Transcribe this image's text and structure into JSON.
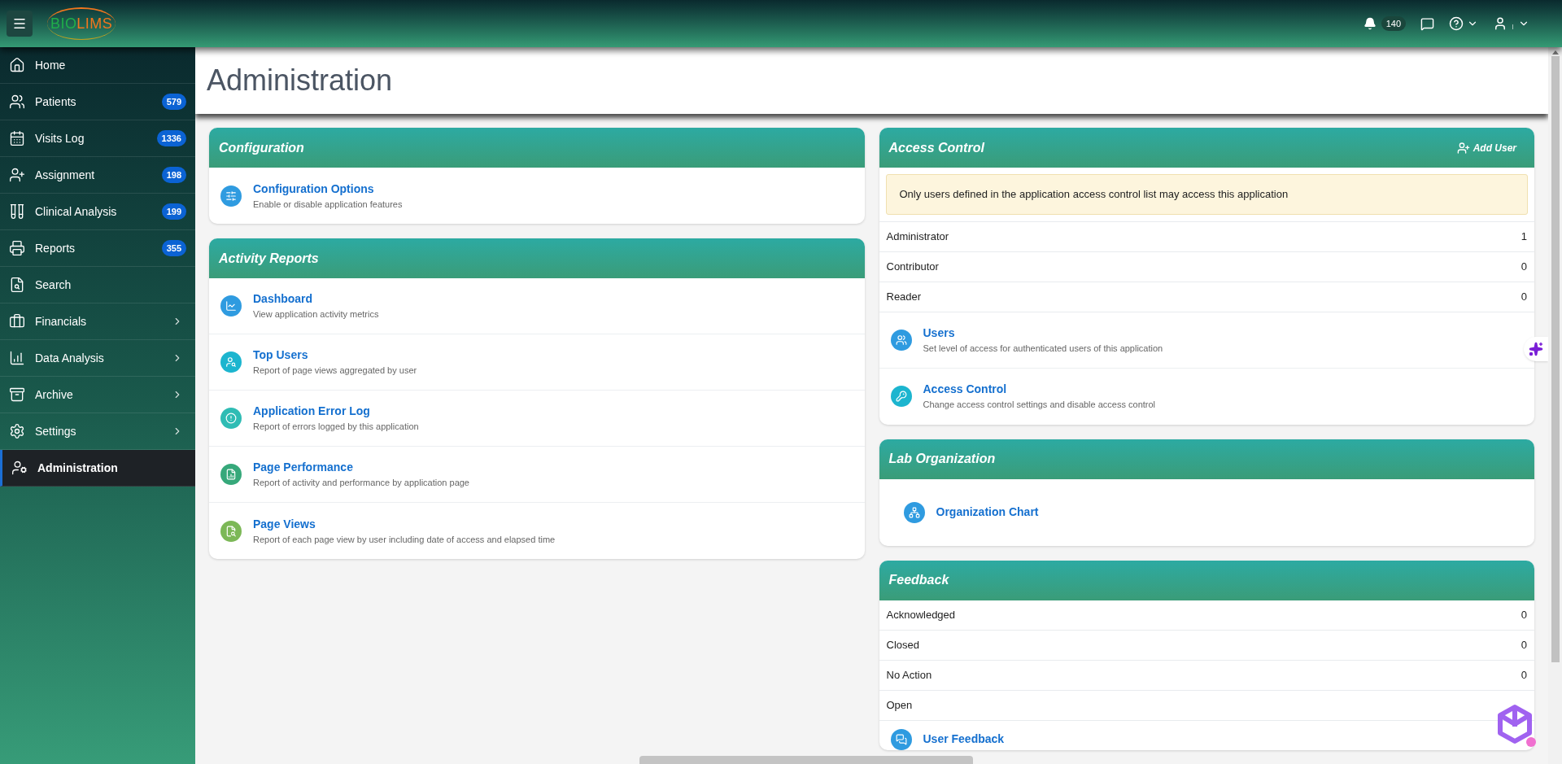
{
  "header": {
    "logo": [
      {
        "text": "BIO",
        "color": "#1fae4a"
      },
      {
        "text": "LIMS",
        "color": "#f0761e"
      }
    ],
    "notifications": "140"
  },
  "sidebar": {
    "items": [
      {
        "label": "Home",
        "has_children": false,
        "selected": false
      },
      {
        "label": "Patients",
        "badge": "579",
        "has_children": false,
        "selected": false
      },
      {
        "label": "Visits Log",
        "badge": "1336",
        "has_children": false,
        "selected": false
      },
      {
        "label": "Assignment",
        "badge": "198",
        "has_children": false,
        "selected": false
      },
      {
        "label": "Clinical Analysis",
        "badge": "199",
        "has_children": false,
        "selected": false
      },
      {
        "label": "Reports",
        "badge": "355",
        "has_children": false,
        "selected": false
      },
      {
        "label": "Search",
        "has_children": false,
        "selected": false
      },
      {
        "label": "Financials",
        "has_children": true,
        "selected": false
      },
      {
        "label": "Data Analysis",
        "has_children": true,
        "selected": false
      },
      {
        "label": "Archive",
        "has_children": true,
        "selected": false
      },
      {
        "label": "Settings",
        "has_children": true,
        "selected": false
      },
      {
        "label": "Administration",
        "has_children": false,
        "selected": true
      }
    ]
  },
  "page": {
    "title": "Administration"
  },
  "left_panels": [
    {
      "title": "Configuration",
      "links": [
        {
          "title": "Configuration Options",
          "description": "Enable or disable application features",
          "color": "#2f9be0"
        }
      ]
    },
    {
      "title": "Activity Reports",
      "links": [
        {
          "title": "Dashboard",
          "description": "View application activity metrics",
          "color": "#2f9be0"
        },
        {
          "title": "Top Users",
          "description": "Report of page views aggregated by user",
          "color": "#1cb5cf"
        },
        {
          "title": "Application Error Log",
          "description": "Report of errors logged by this application",
          "color": "#2fbcb4"
        },
        {
          "title": "Page Performance",
          "description": "Report of activity and performance by application page",
          "color": "#36a87a"
        },
        {
          "title": "Page Views",
          "description": "Report of each page view by user including date of access and elapsed time",
          "color": "#7cb857"
        }
      ]
    }
  ],
  "access_control": {
    "title": "Access Control",
    "action": "Add User",
    "alert": "Only users defined in the application access control list may access this application",
    "counts": [
      {
        "label": "Administrator",
        "value": "1"
      },
      {
        "label": "Contributor",
        "value": "0"
      },
      {
        "label": "Reader",
        "value": "0"
      }
    ],
    "links": [
      {
        "title": "Users",
        "description": "Set level of access for authenticated users of this application",
        "color": "#2f9be0"
      },
      {
        "title": "Access Control",
        "description": "Change access control settings and disable access control",
        "color": "#1cb5cf"
      }
    ]
  },
  "lab_organization": {
    "title": "Lab Organization",
    "links": [
      {
        "title": "Organization Chart",
        "color": "#2f9be0"
      }
    ]
  },
  "feedback": {
    "title": "Feedback",
    "counts": [
      {
        "label": "Acknowledged",
        "value": "0"
      },
      {
        "label": "Closed",
        "value": "0"
      },
      {
        "label": "No Action",
        "value": "0"
      },
      {
        "label": "Open"
      }
    ],
    "links": [
      {
        "title": "User Feedback",
        "color": "#2f9be0"
      }
    ]
  }
}
